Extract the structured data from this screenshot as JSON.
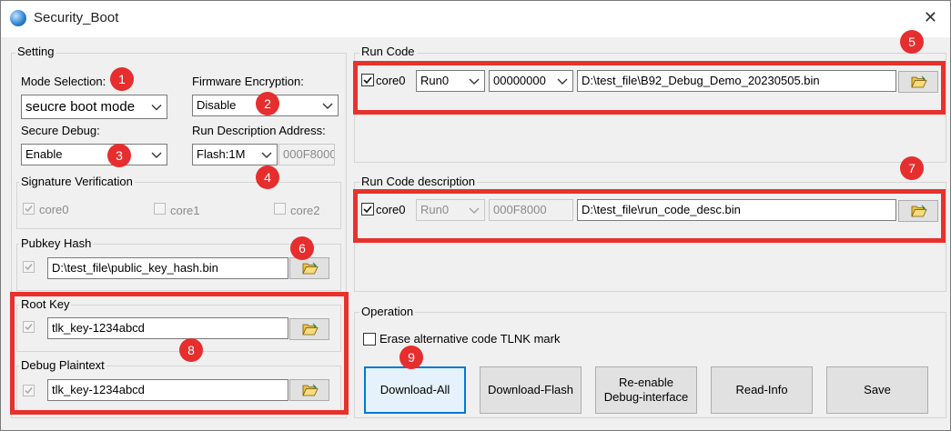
{
  "window": {
    "title": "Security_Boot",
    "close_glyph": "✕"
  },
  "setting": {
    "title": "Setting",
    "mode_selection_label": "Mode Selection:",
    "mode_selection_value": "seucre boot mode",
    "firmware_encryption_label": "Firmware Encryption:",
    "firmware_encryption_value": "Disable",
    "secure_debug_label": "Secure Debug:",
    "secure_debug_value": "Enable",
    "run_desc_address_label": "Run Description Address:",
    "run_desc_address_value": "Flash:1M",
    "run_desc_address_hex": "000F8000"
  },
  "signature": {
    "title": "Signature  Verification",
    "cores": [
      "core0",
      "core1",
      "core2"
    ]
  },
  "pubkey": {
    "title": "Pubkey Hash",
    "path": "D:\\test_file\\public_key_hash.bin"
  },
  "rootkey": {
    "title": "Root Key",
    "value": "tlk_key-1234abcd"
  },
  "debug_plaintext": {
    "title": "Debug Plaintext",
    "value": "tlk_key-1234abcd"
  },
  "run_code": {
    "title": "Run Code",
    "core_label": "core0",
    "run_value": "Run0",
    "address_value": "00000000",
    "path": "D:\\test_file\\B92_Debug_Demo_20230505.bin"
  },
  "run_code_desc": {
    "title": "Run Code description",
    "core_label": "core0",
    "run_value": "Run0",
    "address_value": "000F8000",
    "path": "D:\\test_file\\run_code_desc.bin"
  },
  "operation": {
    "title": "Operation",
    "erase_label": "Erase alternative code TLNK mark",
    "buttons": {
      "download_all": "Download-All",
      "download_flash": "Download-Flash",
      "reenable_line1": "Re-enable",
      "reenable_line2": "Debug-interface",
      "read_info": "Read-Info",
      "save": "Save"
    }
  },
  "badges": [
    "1",
    "2",
    "3",
    "4",
    "5",
    "6",
    "7",
    "8",
    "9"
  ],
  "colors": {
    "annotation_red": "#e8312c",
    "badge_red": "#e62e2e",
    "focus_blue": "#0078d7"
  },
  "icons": {
    "app": "globe-icon",
    "browse": "folder-open-icon",
    "close": "close-icon"
  }
}
